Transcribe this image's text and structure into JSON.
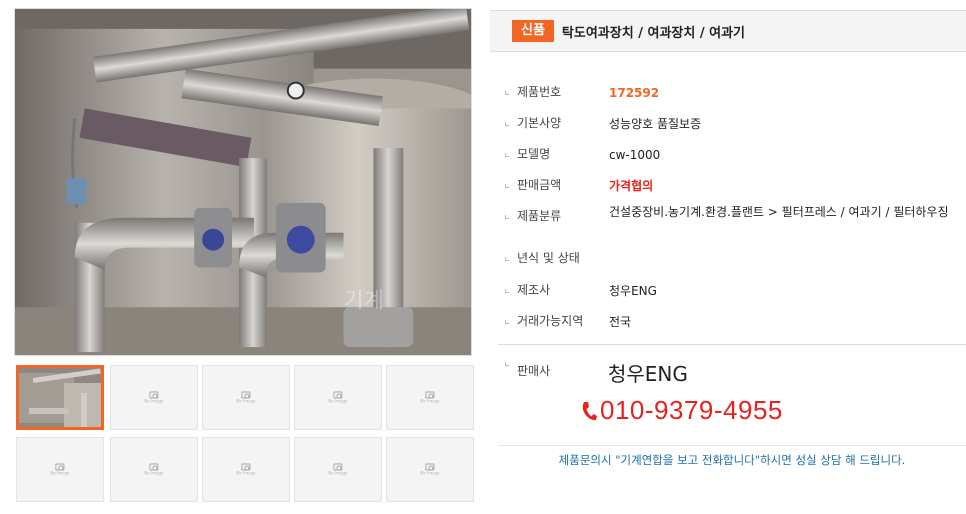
{
  "title_bar": {
    "badge": "신품",
    "category_path": "탁도여과장치 / 여과장치 / 여과기"
  },
  "specs": [
    {
      "label": "제품번호",
      "value": "172592",
      "style": "orange"
    },
    {
      "label": "기본사양",
      "value": "성능양호 품질보증",
      "style": "normal"
    },
    {
      "label": "모델명",
      "value": "cw-1000",
      "style": "normal"
    },
    {
      "label": "판매금액",
      "value": "가격협의",
      "style": "red"
    },
    {
      "label": "제품분류",
      "value": "건설중장비.농기계.환경.플랜트 > 필터프레스 / 여과기 / 필터하우징",
      "style": "normal"
    },
    {
      "label": "년식 및 상태",
      "value": "",
      "style": "normal"
    },
    {
      "label": "제조사",
      "value": "청우ENG",
      "style": "normal"
    },
    {
      "label": "거래가능지역",
      "value": "전국",
      "style": "normal"
    }
  ],
  "seller": {
    "label": "판매사",
    "name": "청우ENG",
    "phone": "010-9379-4955"
  },
  "notice": "제품문의시 \"기계연합을 보고 전화합니다\"하시면 성실 상담 해 드립니다.",
  "thumbnails": {
    "count": 10,
    "selected_index": 0,
    "placeholder_text": "No Image"
  },
  "colors": {
    "accent_orange": "#f26522",
    "price_red": "#e8221b",
    "notice_blue": "#1a6fa5"
  }
}
